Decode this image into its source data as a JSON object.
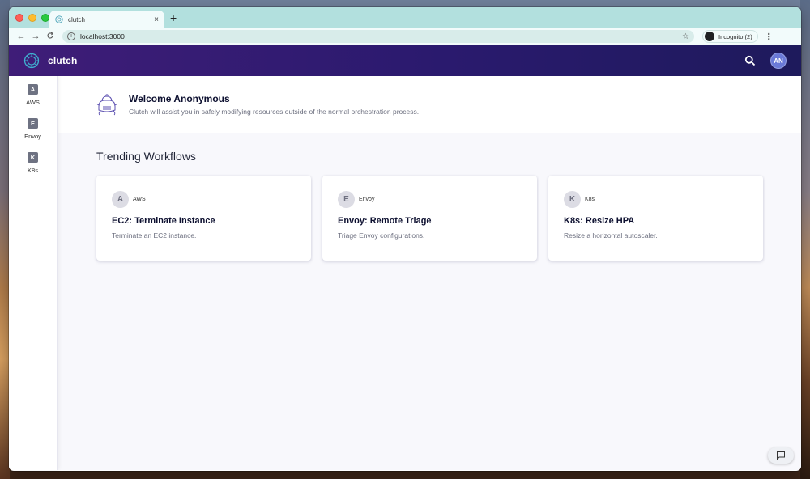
{
  "browser": {
    "tab_title": "clutch",
    "tab_close": "×",
    "new_tab": "+",
    "back": "←",
    "forward": "→",
    "reload": "C",
    "url": "localhost:3000",
    "bookmark": "☆",
    "incognito_label": "Incognito (2)",
    "menu": "⋮"
  },
  "app": {
    "brand": "clutch",
    "avatar_initials": "AN",
    "accent_color": "#3f1d78"
  },
  "sidebar": {
    "items": [
      {
        "letter": "A",
        "label": "AWS"
      },
      {
        "letter": "E",
        "label": "Envoy"
      },
      {
        "letter": "K",
        "label": "K8s"
      }
    ]
  },
  "welcome": {
    "title": "Welcome Anonymous",
    "subtitle": "Clutch will assist you in safely modifying resources outside of the normal orchestration process."
  },
  "trending": {
    "heading": "Trending Workflows",
    "cards": [
      {
        "letter": "A",
        "group": "AWS",
        "title": "EC2: Terminate Instance",
        "description": "Terminate an EC2 instance."
      },
      {
        "letter": "E",
        "group": "Envoy",
        "title": "Envoy: Remote Triage",
        "description": "Triage Envoy configurations."
      },
      {
        "letter": "K",
        "group": "K8s",
        "title": "K8s: Resize HPA",
        "description": "Resize a horizontal autoscaler."
      }
    ]
  }
}
